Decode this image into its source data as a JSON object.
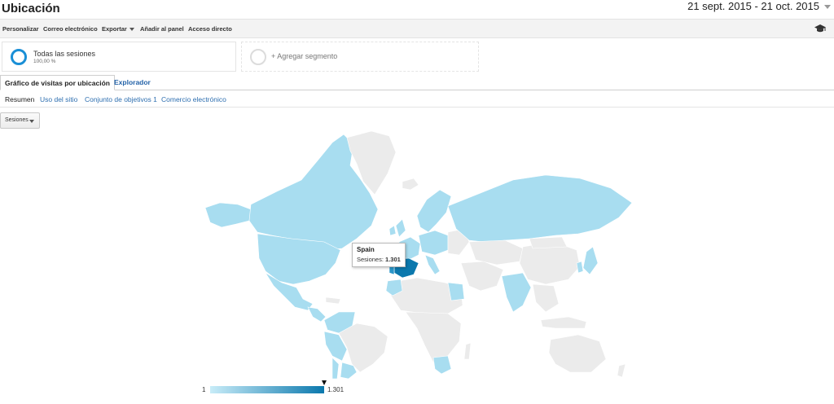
{
  "page": {
    "title": "Ubicación",
    "date_range": "21 sept. 2015 - 21 oct. 2015"
  },
  "toolbar": {
    "personalizar": "Personalizar",
    "correo": "Correo electrónico",
    "exportar": "Exportar",
    "anadir": "Añadir al panel",
    "acceso": "Acceso directo",
    "help_icon": "graduation-cap-icon"
  },
  "segments": {
    "active_name": "Todas las sesiones",
    "active_pct": "100,00 %",
    "add_label": "+ Agregar segmento"
  },
  "tabs": {
    "active": "Gráfico de visitas por ubicación",
    "explorer": "Explorador"
  },
  "subnav": [
    "Resumen",
    "Uso del sitio",
    "Conjunto de objetivos 1",
    "Comercio electrónico"
  ],
  "metric": {
    "selected": "Sesiones"
  },
  "map": {
    "tooltip": {
      "country": "Spain",
      "metric_label": "Sesiones:",
      "value": "1.301"
    },
    "legend": {
      "min": "1",
      "max": "1.301"
    },
    "colors": {
      "no_data": "#ebebeb",
      "low": "#a8ddf0",
      "high": "#0b78ad",
      "border": "#ffffff"
    }
  }
}
